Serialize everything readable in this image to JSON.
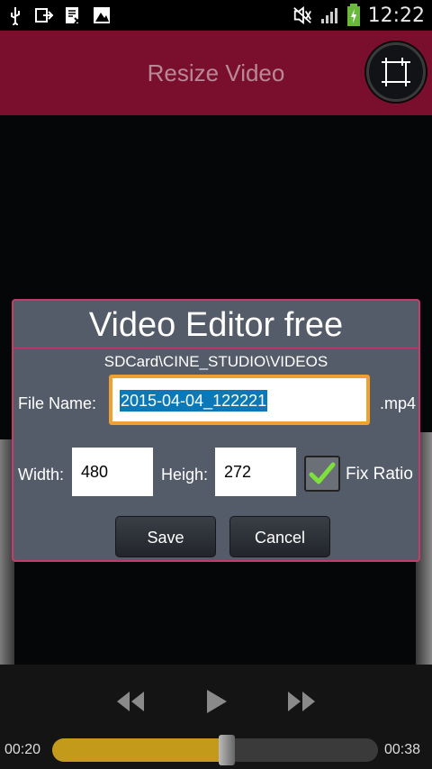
{
  "status_bar": {
    "time": "12:22",
    "icons": [
      "usb-icon",
      "screen-share-icon",
      "document-icon",
      "image-icon",
      "mute-icon",
      "signal-icon",
      "battery-charging-icon"
    ]
  },
  "app_bar": {
    "title": "Resize Video",
    "action_icon": "crop-icon"
  },
  "dialog": {
    "title": "Video Editor free",
    "path": "SDCard\\CINE_STUDIO\\VIDEOS",
    "file_name_label": "File Name:",
    "file_name_value": "2015-04-04_122221",
    "extension": ".mp4",
    "width_label": "Width:",
    "width_value": "480",
    "height_label": "Heigh:",
    "height_value": "272",
    "fix_ratio_label": "Fix Ratio",
    "fix_ratio_checked": true,
    "save_label": "Save",
    "cancel_label": "Cancel",
    "accent_color": "#c83a6a"
  },
  "player": {
    "current_time": "00:20",
    "total_time": "00:38",
    "progress": 0.53,
    "progress_color": "#c49a1a"
  }
}
